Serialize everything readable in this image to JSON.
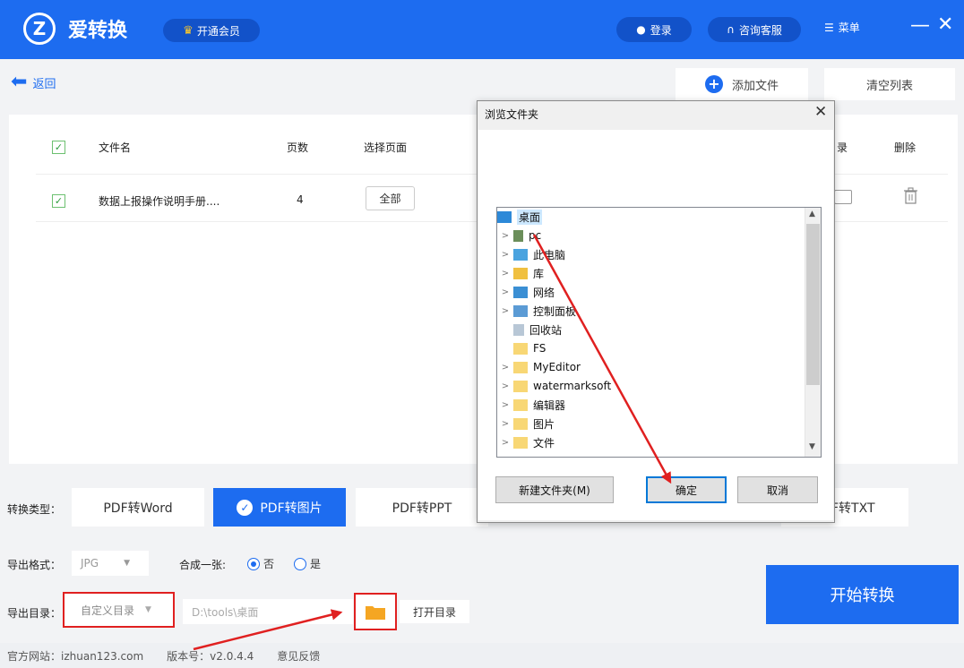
{
  "header": {
    "logo": "Z",
    "title": "爱转换",
    "vip": "开通会员",
    "login": "登录",
    "service": "咨询客服",
    "menu": "菜单",
    "minimize": "—",
    "close": "✕"
  },
  "toolbar": {
    "back": "返回",
    "add_file": "添加文件",
    "clear_list": "清空列表"
  },
  "table": {
    "columns": [
      "文件名",
      "页数",
      "选择页面",
      "录",
      "删除"
    ],
    "rows": [
      {
        "name": "数据上报操作说明手册....",
        "pages": "4",
        "select": "全部"
      }
    ]
  },
  "convert": {
    "type_label": "转换类型：",
    "types": [
      "PDF转Word",
      "PDF转图片",
      "PDF转PPT",
      "F转TXT"
    ],
    "selected": "PDF转图片",
    "format_label": "导出格式：",
    "format_value": "JPG",
    "merge_label": "合成一张:",
    "merge_no": "否",
    "merge_yes": "是",
    "dir_label": "导出目录：",
    "dir_mode": "自定义目录",
    "dir_path": "D:\\tools\\桌面",
    "open_dir": "打开目录",
    "start": "开始转换"
  },
  "footer": {
    "site": "官方网站：izhuan123.com",
    "version": "版本号：v2.0.4.4",
    "feedback": "意见反馈"
  },
  "dialog": {
    "title": "浏览文件夹",
    "tree": [
      "桌面",
      "pc",
      "此电脑",
      "库",
      "网络",
      "控制面板",
      "回收站",
      "FS",
      "MyEditor",
      "watermarksoft",
      "编辑器",
      "图片",
      "文件"
    ],
    "new_folder": "新建文件夹(M)",
    "ok": "确定",
    "cancel": "取消"
  },
  "colors": {
    "brand": "#1d6cf0",
    "annotation": "#e02020"
  }
}
